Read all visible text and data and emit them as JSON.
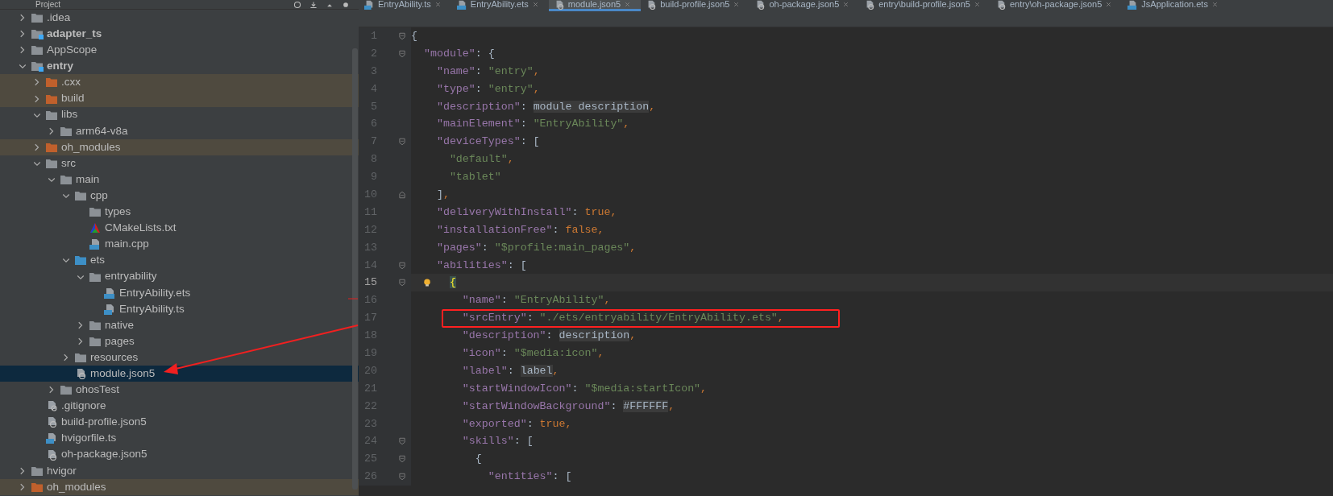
{
  "project_panel": {
    "title": "Project",
    "items": [
      {
        "label": ".idea",
        "kind": "folder",
        "expanded": false,
        "selected": false
      },
      {
        "label": "adapter_ts",
        "kind": "module",
        "expanded": false,
        "selected": false
      },
      {
        "label": "AppScope",
        "kind": "folder",
        "expanded": false,
        "selected": false
      },
      {
        "label": "entry",
        "kind": "module",
        "expanded": true,
        "selected": false,
        "children": [
          {
            "label": ".cxx",
            "kind": "excluded",
            "expanded": false,
            "selected": false
          },
          {
            "label": "build",
            "kind": "excluded",
            "expanded": false,
            "selected": false
          },
          {
            "label": "libs",
            "kind": "folder",
            "expanded": true,
            "selected": false,
            "children": [
              {
                "label": "arm64-v8a",
                "kind": "folder",
                "expanded": false,
                "selected": false
              }
            ]
          },
          {
            "label": "oh_modules",
            "kind": "excluded",
            "expanded": false,
            "selected": false
          },
          {
            "label": "src",
            "kind": "folder",
            "expanded": true,
            "selected": false,
            "children": [
              {
                "label": "main",
                "kind": "folder",
                "expanded": true,
                "selected": false,
                "children": [
                  {
                    "label": "cpp",
                    "kind": "folder",
                    "expanded": true,
                    "selected": false,
                    "children": [
                      {
                        "label": "types",
                        "kind": "leaf-folder",
                        "selected": false
                      },
                      {
                        "label": "CMakeLists.txt",
                        "kind": "cmake",
                        "selected": false
                      },
                      {
                        "label": "main.cpp",
                        "kind": "cpp",
                        "selected": false
                      }
                    ]
                  },
                  {
                    "label": "ets",
                    "kind": "source",
                    "expanded": true,
                    "selected": false,
                    "children": [
                      {
                        "label": "entryability",
                        "kind": "folder",
                        "expanded": true,
                        "selected": false,
                        "children": [
                          {
                            "label": "EntryAbility.ets",
                            "kind": "ets",
                            "selected": false
                          },
                          {
                            "label": "EntryAbility.ts",
                            "kind": "ts",
                            "selected": false
                          }
                        ]
                      },
                      {
                        "label": "native",
                        "kind": "folder",
                        "expanded": false,
                        "selected": false
                      },
                      {
                        "label": "pages",
                        "kind": "folder",
                        "expanded": false,
                        "selected": false
                      }
                    ]
                  },
                  {
                    "label": "resources",
                    "kind": "folder",
                    "expanded": false,
                    "selected": false
                  },
                  {
                    "label": "module.json5",
                    "kind": "json5",
                    "selected": true
                  }
                ]
              },
              {
                "label": "ohosTest",
                "kind": "folder",
                "expanded": false,
                "selected": false
              }
            ]
          },
          {
            "label": ".gitignore",
            "kind": "gitignore",
            "selected": false
          },
          {
            "label": "build-profile.json5",
            "kind": "json5",
            "selected": false
          },
          {
            "label": "hvigorfile.ts",
            "kind": "ts",
            "selected": false
          },
          {
            "label": "oh-package.json5",
            "kind": "json5",
            "selected": false
          }
        ]
      },
      {
        "label": "hvigor",
        "kind": "folder",
        "expanded": false,
        "selected": false
      },
      {
        "label": "oh_modules",
        "kind": "excluded",
        "expanded": false,
        "selected": false
      }
    ]
  },
  "tabs": [
    {
      "label": "EntryAbility.ts",
      "kind": "ts",
      "selected": false
    },
    {
      "label": "EntryAbility.ets",
      "kind": "ets",
      "selected": false
    },
    {
      "label": "module.json5",
      "kind": "json5",
      "selected": true
    },
    {
      "label": "build-profile.json5",
      "kind": "json5",
      "selected": false
    },
    {
      "label": "oh-package.json5",
      "kind": "json5",
      "selected": false
    },
    {
      "label": "entry\\build-profile.json5",
      "kind": "json5",
      "selected": false
    },
    {
      "label": "entry\\oh-package.json5",
      "kind": "json5",
      "selected": false
    },
    {
      "label": "JsApplication.ets",
      "kind": "ets",
      "selected": false
    }
  ],
  "editor": {
    "lines": [
      {
        "number": "1",
        "fold_start": true,
        "fold_end": false,
        "current": false,
        "boxed": false,
        "tokens": [
          {
            "kind": "plain",
            "text": "{"
          }
        ]
      },
      {
        "number": "2",
        "fold_start": true,
        "fold_end": false,
        "current": false,
        "boxed": false,
        "tokens": [
          {
            "kind": "key",
            "text": "  \"module\""
          },
          {
            "kind": "plain",
            "text": ": {"
          }
        ]
      },
      {
        "number": "3",
        "fold_start": false,
        "fold_end": false,
        "current": false,
        "boxed": false,
        "tokens": [
          {
            "kind": "key",
            "text": "    \"name\""
          },
          {
            "kind": "plain",
            "text": ": "
          },
          {
            "kind": "string",
            "text": "\"entry\""
          },
          {
            "kind": "comma",
            "text": ","
          }
        ]
      },
      {
        "number": "4",
        "fold_start": false,
        "fold_end": false,
        "current": false,
        "boxed": false,
        "tokens": [
          {
            "kind": "key",
            "text": "    \"type\""
          },
          {
            "kind": "plain",
            "text": ": "
          },
          {
            "kind": "string",
            "text": "\"entry\""
          },
          {
            "kind": "comma",
            "text": ","
          }
        ]
      },
      {
        "number": "5",
        "fold_start": false,
        "fold_end": false,
        "current": false,
        "boxed": false,
        "tokens": [
          {
            "kind": "key",
            "text": "    \"description\""
          },
          {
            "kind": "plain",
            "text": ": "
          },
          {
            "kind": "ref",
            "text": "module description"
          },
          {
            "kind": "comma",
            "text": ","
          }
        ]
      },
      {
        "number": "6",
        "fold_start": false,
        "fold_end": false,
        "current": false,
        "boxed": false,
        "tokens": [
          {
            "kind": "key",
            "text": "    \"mainElement\""
          },
          {
            "kind": "plain",
            "text": ": "
          },
          {
            "kind": "string",
            "text": "\"EntryAbility\""
          },
          {
            "kind": "comma",
            "text": ","
          }
        ]
      },
      {
        "number": "7",
        "fold_start": true,
        "fold_end": false,
        "current": false,
        "boxed": false,
        "tokens": [
          {
            "kind": "key",
            "text": "    \"deviceTypes\""
          },
          {
            "kind": "plain",
            "text": ": ["
          }
        ]
      },
      {
        "number": "8",
        "fold_start": false,
        "fold_end": false,
        "current": false,
        "boxed": false,
        "tokens": [
          {
            "kind": "string",
            "text": "      \"default\""
          },
          {
            "kind": "comma",
            "text": ","
          }
        ]
      },
      {
        "number": "9",
        "fold_start": false,
        "fold_end": false,
        "current": false,
        "boxed": false,
        "tokens": [
          {
            "kind": "string",
            "text": "      \"tablet\""
          }
        ]
      },
      {
        "number": "10",
        "fold_start": false,
        "fold_end": true,
        "current": false,
        "boxed": false,
        "tokens": [
          {
            "kind": "plain",
            "text": "    ]"
          },
          {
            "kind": "comma",
            "text": ","
          }
        ]
      },
      {
        "number": "11",
        "fold_start": false,
        "fold_end": false,
        "current": false,
        "boxed": false,
        "tokens": [
          {
            "kind": "key",
            "text": "    \"deliveryWithInstall\""
          },
          {
            "kind": "plain",
            "text": ": "
          },
          {
            "kind": "literal",
            "text": "true"
          },
          {
            "kind": "comma",
            "text": ","
          }
        ]
      },
      {
        "number": "12",
        "fold_start": false,
        "fold_end": false,
        "current": false,
        "boxed": false,
        "tokens": [
          {
            "kind": "key",
            "text": "    \"installationFree\""
          },
          {
            "kind": "plain",
            "text": ": "
          },
          {
            "kind": "literal",
            "text": "false"
          },
          {
            "kind": "comma",
            "text": ","
          }
        ]
      },
      {
        "number": "13",
        "fold_start": false,
        "fold_end": false,
        "current": false,
        "boxed": false,
        "tokens": [
          {
            "kind": "key",
            "text": "    \"pages\""
          },
          {
            "kind": "plain",
            "text": ": "
          },
          {
            "kind": "string",
            "text": "\"$profile:main_pages\""
          },
          {
            "kind": "comma",
            "text": ","
          }
        ]
      },
      {
        "number": "14",
        "fold_start": true,
        "fold_end": false,
        "current": false,
        "boxed": false,
        "tokens": [
          {
            "kind": "key",
            "text": "    \"abilities\""
          },
          {
            "kind": "plain",
            "text": ": ["
          }
        ]
      },
      {
        "number": "15",
        "fold_start": true,
        "fold_end": false,
        "current": true,
        "boxed": false,
        "tokens": [
          {
            "kind": "match",
            "text": "      {"
          }
        ]
      },
      {
        "number": "16",
        "fold_start": false,
        "fold_end": false,
        "current": false,
        "boxed": false,
        "tokens": [
          {
            "kind": "key",
            "text": "        \"name\""
          },
          {
            "kind": "plain",
            "text": ": "
          },
          {
            "kind": "string",
            "text": "\"EntryAbility\""
          },
          {
            "kind": "comma",
            "text": ","
          }
        ]
      },
      {
        "number": "17",
        "fold_start": false,
        "fold_end": false,
        "current": false,
        "boxed": true,
        "tokens": [
          {
            "kind": "key",
            "text": "        \"srcEntry\""
          },
          {
            "kind": "plain",
            "text": ": "
          },
          {
            "kind": "string",
            "text": "\"./ets/entryability/EntryAbility.ets\""
          },
          {
            "kind": "comma",
            "text": ","
          }
        ]
      },
      {
        "number": "18",
        "fold_start": false,
        "fold_end": false,
        "current": false,
        "boxed": false,
        "tokens": [
          {
            "kind": "key",
            "text": "        \"description\""
          },
          {
            "kind": "plain",
            "text": ": "
          },
          {
            "kind": "ref",
            "text": "description"
          },
          {
            "kind": "comma",
            "text": ","
          }
        ]
      },
      {
        "number": "19",
        "fold_start": false,
        "fold_end": false,
        "current": false,
        "boxed": false,
        "tokens": [
          {
            "kind": "key",
            "text": "        \"icon\""
          },
          {
            "kind": "plain",
            "text": ": "
          },
          {
            "kind": "string",
            "text": "\"$media:icon\""
          },
          {
            "kind": "comma",
            "text": ","
          }
        ]
      },
      {
        "number": "20",
        "fold_start": false,
        "fold_end": false,
        "current": false,
        "boxed": false,
        "tokens": [
          {
            "kind": "key",
            "text": "        \"label\""
          },
          {
            "kind": "plain",
            "text": ": "
          },
          {
            "kind": "ref",
            "text": "label"
          },
          {
            "kind": "comma",
            "text": ","
          }
        ]
      },
      {
        "number": "21",
        "fold_start": false,
        "fold_end": false,
        "current": false,
        "boxed": false,
        "tokens": [
          {
            "kind": "key",
            "text": "        \"startWindowIcon\""
          },
          {
            "kind": "plain",
            "text": ": "
          },
          {
            "kind": "string",
            "text": "\"$media:startIcon\""
          },
          {
            "kind": "comma",
            "text": ","
          }
        ]
      },
      {
        "number": "22",
        "fold_start": false,
        "fold_end": false,
        "current": false,
        "boxed": false,
        "tokens": [
          {
            "kind": "key",
            "text": "        \"startWindowBackground\""
          },
          {
            "kind": "plain",
            "text": ": "
          },
          {
            "kind": "ref",
            "text": "#FFFFFF"
          },
          {
            "kind": "comma",
            "text": ","
          }
        ]
      },
      {
        "number": "23",
        "fold_start": false,
        "fold_end": false,
        "current": false,
        "boxed": false,
        "tokens": [
          {
            "kind": "key",
            "text": "        \"exported\""
          },
          {
            "kind": "plain",
            "text": ": "
          },
          {
            "kind": "literal",
            "text": "true"
          },
          {
            "kind": "comma",
            "text": ","
          }
        ]
      },
      {
        "number": "24",
        "fold_start": true,
        "fold_end": false,
        "current": false,
        "boxed": false,
        "tokens": [
          {
            "kind": "key",
            "text": "        \"skills\""
          },
          {
            "kind": "plain",
            "text": ": ["
          }
        ]
      },
      {
        "number": "25",
        "fold_start": true,
        "fold_end": false,
        "current": false,
        "boxed": false,
        "tokens": [
          {
            "kind": "plain",
            "text": "          {"
          }
        ]
      },
      {
        "number": "26",
        "fold_start": true,
        "fold_end": false,
        "current": false,
        "boxed": false,
        "tokens": [
          {
            "kind": "key",
            "text": "            \"entities\""
          },
          {
            "kind": "plain",
            "text": ": ["
          }
        ]
      }
    ]
  }
}
